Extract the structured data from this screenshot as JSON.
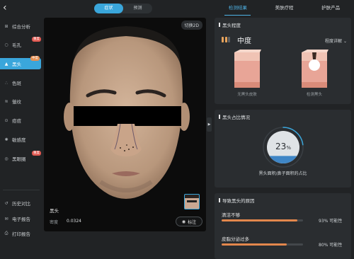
{
  "header": {
    "mode_tabs": [
      "症状",
      "预测"
    ],
    "active_mode": 0,
    "right_tabs": [
      "检测结果",
      "美肤疗程",
      "护肤产品"
    ],
    "active_right_tab": 0
  },
  "sidebar": {
    "items": [
      {
        "label": "综合分析",
        "icon": "grid-icon"
      },
      {
        "label": "毛孔",
        "icon": "circle-icon",
        "badge": "重度"
      },
      {
        "label": "黑头",
        "icon": "triangle-icon",
        "badge": "中度",
        "active": true
      },
      {
        "label": "色斑",
        "icon": "dots-icon"
      },
      {
        "label": "皱纹",
        "icon": "wave-icon"
      },
      {
        "label": "痘痘",
        "icon": "pimple-icon"
      },
      {
        "label": "敏感度",
        "icon": "sensitive-icon"
      },
      {
        "label": "黑眼圈",
        "icon": "eye-circle-icon",
        "badge": "重度"
      }
    ],
    "footer": [
      {
        "label": "历史对比",
        "icon": "history-icon"
      },
      {
        "label": "电子报告",
        "icon": "report-icon"
      },
      {
        "label": "打印报告",
        "icon": "print-icon"
      }
    ]
  },
  "face_panel": {
    "view_toggle": "切换2D",
    "info_title": "黑头",
    "density_label": "密度",
    "density_value": "0.0324",
    "mark_button": "标注"
  },
  "severity_card": {
    "title": "黑头程度",
    "level": "中度",
    "detail_link": "程度详解",
    "illus_left_label": "无黑头皮肤",
    "illus_right_label": "检测黑头",
    "colors": {
      "active": "#e7a35c",
      "inactive": "#5a5f63"
    }
  },
  "ratio_card": {
    "title": "黑头占比情况",
    "percent": 23,
    "percent_text": "23",
    "percent_sign": "%",
    "caption": "黑头面积/鼻子面积的占比"
  },
  "causes_card": {
    "title": "导致黑头的原因",
    "items": [
      {
        "name": "清洁不够",
        "percent": 93,
        "pct_text": "93%",
        "suffix": "可能性"
      },
      {
        "name": "皮脂分泌过多",
        "percent": 80,
        "pct_text": "80%",
        "suffix": "可能性"
      }
    ]
  },
  "colors": {
    "accent": "#3aa6db",
    "bar": "#e3874c",
    "badge": "#e0574f"
  }
}
